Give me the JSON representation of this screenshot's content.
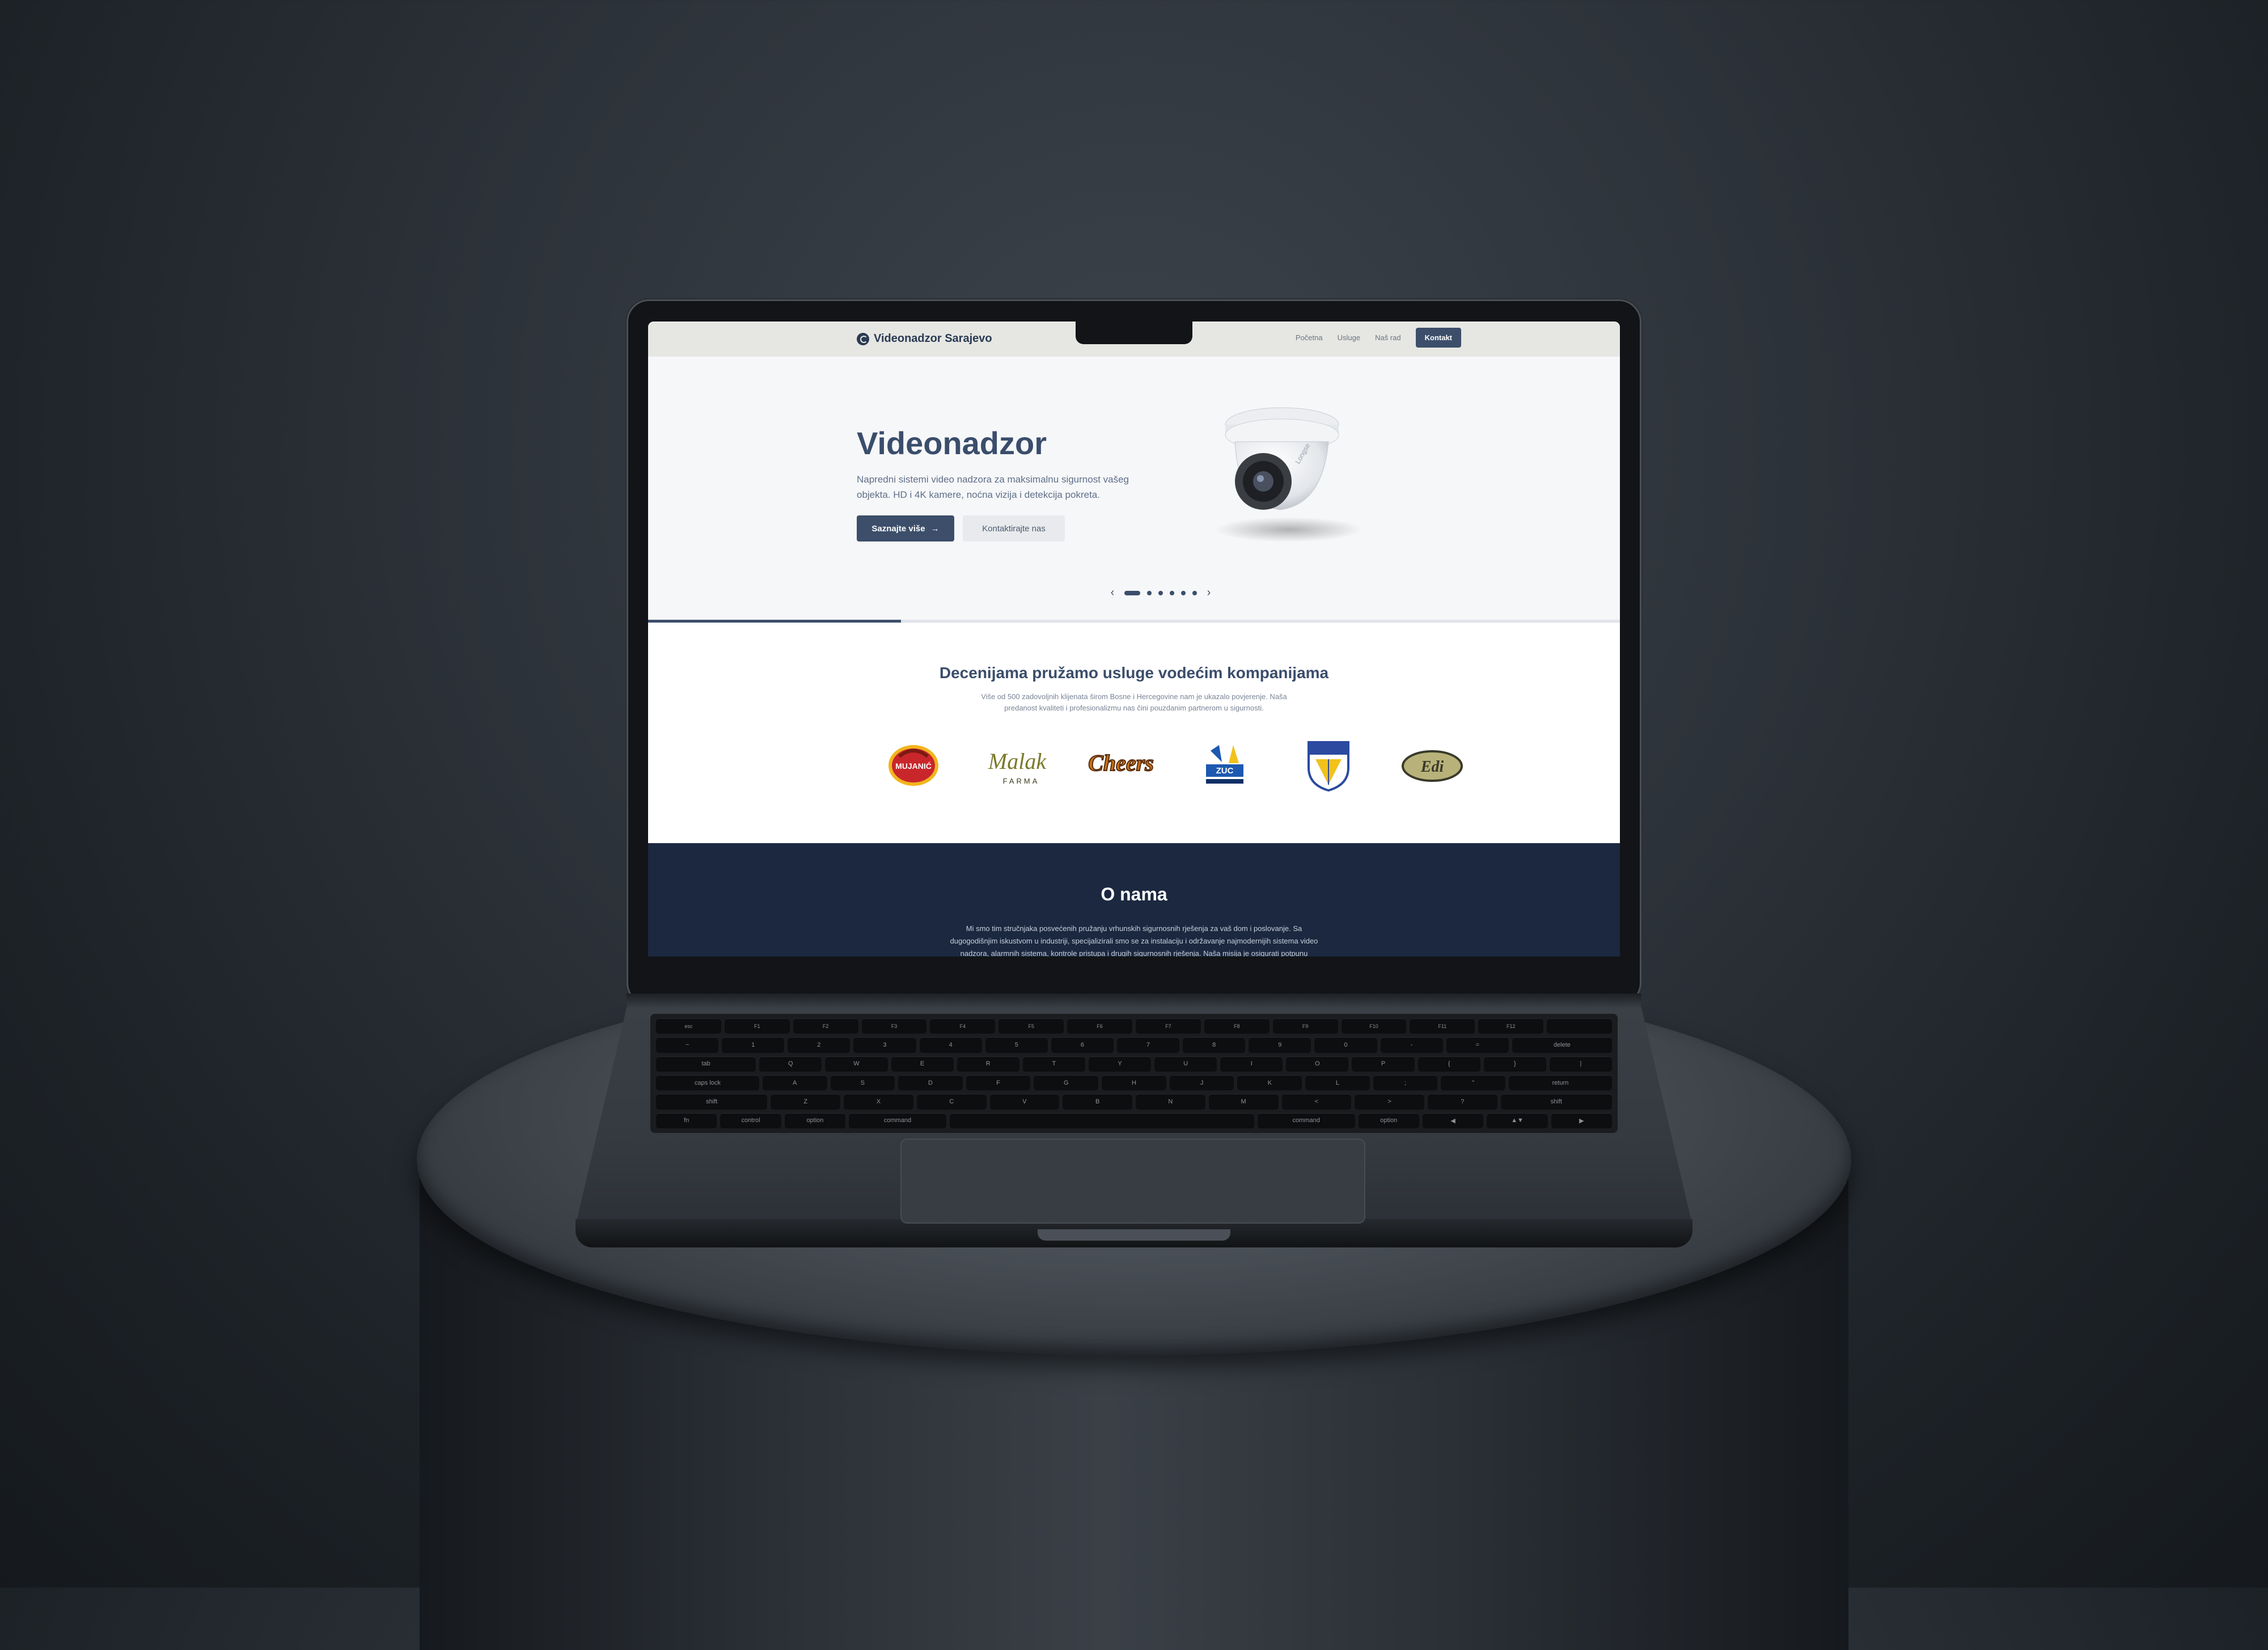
{
  "site": {
    "brand": "Videonadzor Sarajevo",
    "nav": {
      "home": "Početna",
      "services": "Usluge",
      "work": "Naš rad",
      "contact": "Kontakt"
    },
    "hero": {
      "title": "Videonadzor",
      "description": "Napredni sistemi video nadzora za maksimalnu sigurnost vašeg objekta. HD i 4K kamere, noćna vizija i detekcija pokreta.",
      "primary_button": "Saznajte više",
      "secondary_button": "Kontaktirajte nas",
      "camera_brand": "Longse",
      "slide_count": 6,
      "active_slide": 1,
      "progress": 0.26
    },
    "clients": {
      "title": "Decenijama pružamo usluge vodećim kompanijama",
      "subtitle": "Više od 500 zadovoljnih klijenata širom Bosne i Hercegovine nam je ukazalo povjerenje. Naša predanost kvaliteti i profesionalizmu nas čini pouzdanim partnerom u sigurnosti.",
      "logos": [
        {
          "name": "Mujanić",
          "text": "MUJANIĆ",
          "colors": [
            "#c9262b",
            "#f2b51d"
          ]
        },
        {
          "name": "Malak Farma",
          "text": "Malak",
          "subtext": "FARMA",
          "colors": [
            "#7a7a2a",
            "#3a3a1a"
          ]
        },
        {
          "name": "Cheers",
          "text": "Cheers",
          "colors": [
            "#c8731a",
            "#5a2e0e"
          ]
        },
        {
          "name": "ZUC",
          "text": "ZUC",
          "colors": [
            "#1d59b0",
            "#f2c21b"
          ]
        },
        {
          "name": "Grb",
          "text": "",
          "colors": [
            "#2b4aa0",
            "#f2c21b"
          ]
        },
        {
          "name": "Edi",
          "text": "Edi",
          "colors": [
            "#3a3a2a",
            "#b8b27a"
          ]
        }
      ]
    },
    "about": {
      "title": "O nama",
      "text": "Mi smo tim stručnjaka posvećenih pružanju vrhunskih sigurnosnih rješenja za vaš dom i poslovanje. Sa dugogodišnjim iskustvom u industriji, specijalizirali smo se za instalaciju i održavanje najmodernijih sistema video nadzora, alarmnih sistema, kontrole pristupa i drugih sigurnosnih rješenja. Naša misija je osigurati potpunu sigurnost i mir uma našim"
    }
  },
  "keyboard": {
    "rows": [
      [
        "esc",
        "F1",
        "F2",
        "F3",
        "F4",
        "F5",
        "F6",
        "F7",
        "F8",
        "F9",
        "F10",
        "F11",
        "F12",
        ""
      ],
      [
        "~",
        "1",
        "2",
        "3",
        "4",
        "5",
        "6",
        "7",
        "8",
        "9",
        "0",
        "-",
        "=",
        "delete"
      ],
      [
        "tab",
        "Q",
        "W",
        "E",
        "R",
        "T",
        "Y",
        "U",
        "I",
        "O",
        "P",
        "{",
        "}",
        "|"
      ],
      [
        "caps lock",
        "A",
        "S",
        "D",
        "F",
        "G",
        "H",
        "J",
        "K",
        "L",
        ";",
        "\"",
        "return"
      ],
      [
        "shift",
        "Z",
        "X",
        "C",
        "V",
        "B",
        "N",
        "M",
        "<",
        ">",
        "?",
        "shift"
      ],
      [
        "fn",
        "control",
        "option",
        "command",
        "",
        "command",
        "option",
        "◀",
        "▲▼",
        "▶"
      ]
    ]
  },
  "colors": {
    "accent": "#3c4e6a",
    "nav_bg": "#e6e7e3",
    "about_bg": "#1b2840"
  }
}
